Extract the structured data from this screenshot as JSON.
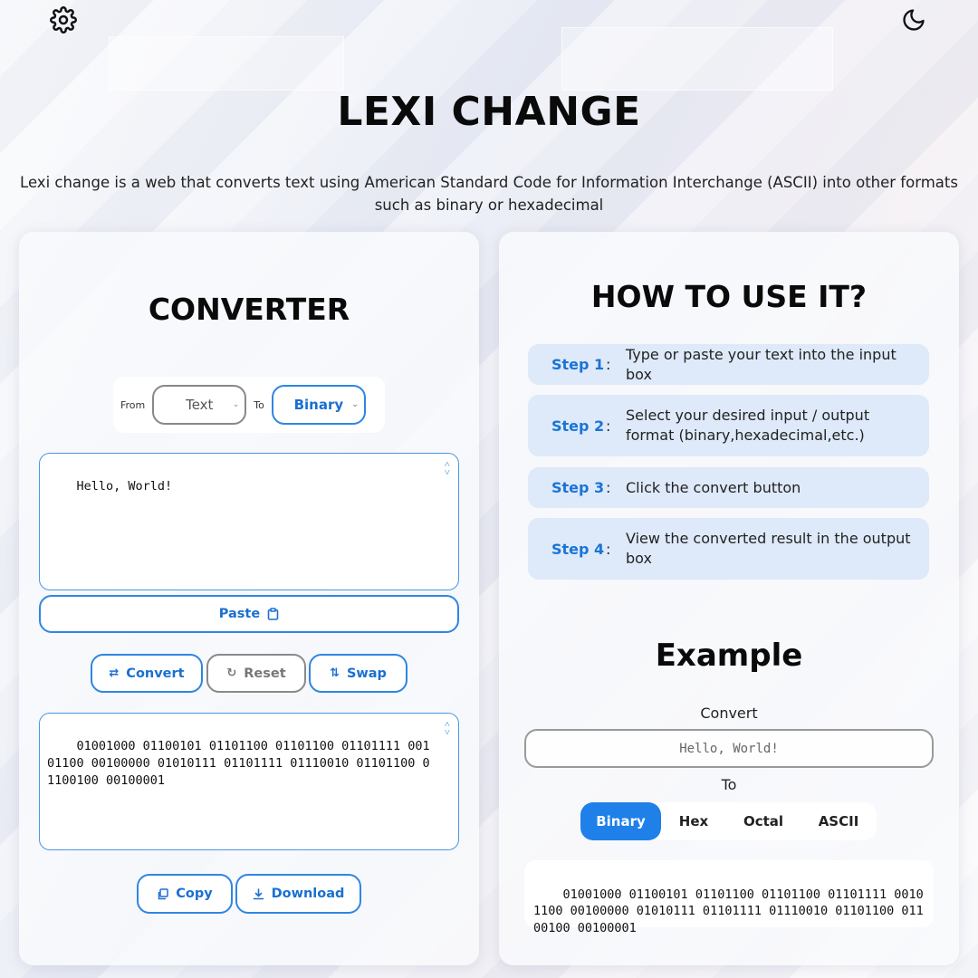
{
  "header": {
    "title": "LEXI CHANGE",
    "description": "Lexi change is a web that converts text using American Standard Code for Information Interchange (ASCII) into other formats such as binary or hexadecimal"
  },
  "icons": {
    "settings": "gear-icon",
    "theme": "moon-icon"
  },
  "converter": {
    "title": "CONVERTER",
    "from_label": "From",
    "from_value": "Text",
    "to_label": "To",
    "to_value": "Binary",
    "input_value": "Hello, World!",
    "paste_label": "Paste",
    "convert_label": "Convert",
    "reset_label": "Reset",
    "swap_label": "Swap",
    "output_value": "01001000 01100101 01101100 01101100 01101111 00101100 00100000 01010111 01101111 01110010 01101100 01100100 00100001",
    "copy_label": "Copy",
    "download_label": "Download"
  },
  "howto": {
    "title": "HOW TO USE IT?",
    "steps": [
      {
        "label": "Step 1",
        "text": "Type or paste your text into the input box"
      },
      {
        "label": "Step 2",
        "text": "Select your desired input / output format (binary,hexadecimal,etc.)"
      },
      {
        "label": "Step 3",
        "text": "Click the convert button"
      },
      {
        "label": "Step 4",
        "text": "View the converted result in the output box"
      }
    ]
  },
  "example": {
    "title": "Example",
    "convert_label": "Convert",
    "input_value": "Hello, World!",
    "to_label": "To",
    "tabs": [
      "Binary",
      "Hex",
      "Octal",
      "ASCII"
    ],
    "active_tab": "Binary",
    "output_value": "01001000 01100101 01101100 01101100 01101111 00101100 00100000 01010111 01101111 01110010 01101100 01100100 00100001"
  },
  "colors": {
    "accent": "#1e80e8",
    "step_bg": "#d6e4f8"
  }
}
